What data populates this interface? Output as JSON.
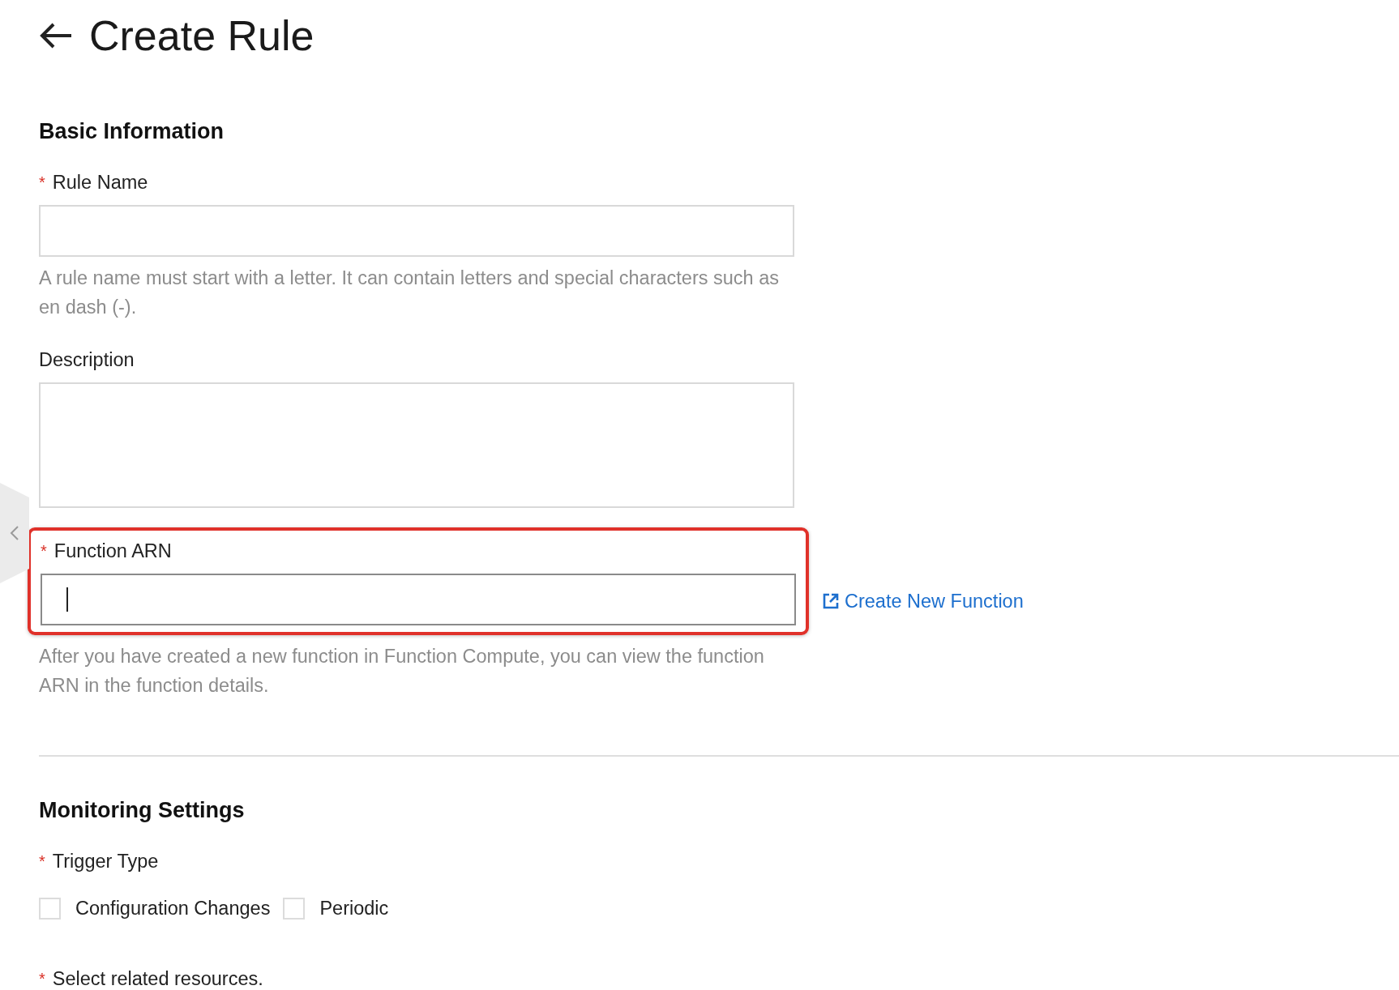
{
  "page": {
    "title": "Create Rule"
  },
  "sections": [
    {
      "title": "Basic Information",
      "fields": [
        {
          "kind": "input",
          "label": "Rule Name",
          "required_mark": "*",
          "focused": false,
          "highlighted": false,
          "help": "A rule name must start with a letter. It can contain letters and special characters such as en dash (-)."
        },
        {
          "kind": "textarea",
          "label": "Description"
        },
        {
          "kind": "input",
          "label": "Function ARN",
          "required_mark": "*",
          "focused": true,
          "highlighted": true,
          "link": "Create New Function",
          "help": "After you have created a new function in Function Compute, you can view the function ARN in the function details."
        }
      ]
    },
    {
      "title": "Monitoring Settings",
      "fields": [
        {
          "kind": "checkboxes",
          "label": "Trigger Type",
          "required_mark": "*",
          "options": [
            {
              "label": "Configuration Changes",
              "checked": false
            },
            {
              "label": "Periodic",
              "checked": false
            }
          ]
        },
        {
          "kind": "label",
          "label": "Select related resources.",
          "required_mark": "*"
        }
      ]
    }
  ]
}
